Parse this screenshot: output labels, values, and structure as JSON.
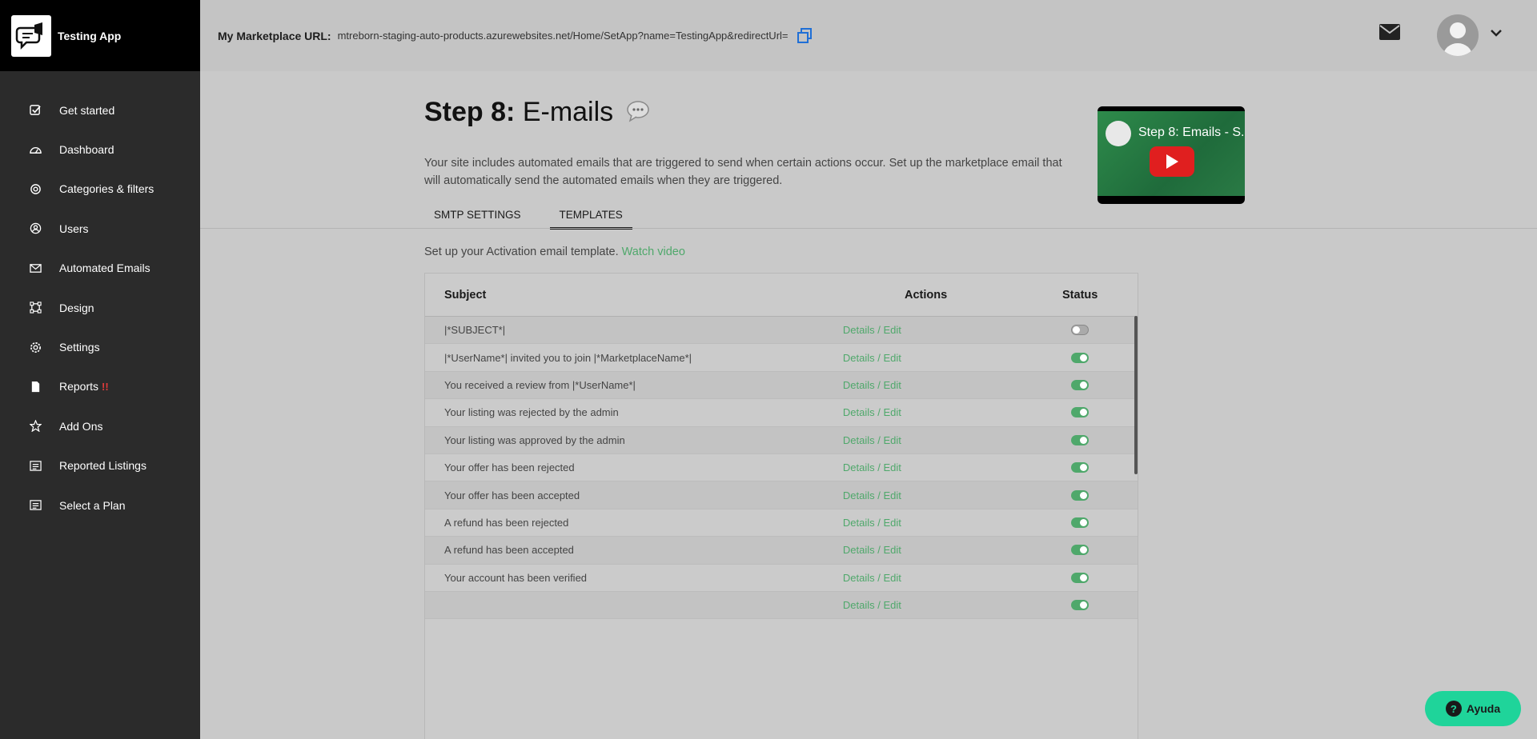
{
  "app": {
    "name": "Testing App"
  },
  "sidebar": {
    "items": [
      {
        "label": "Get started",
        "icon": "checkbox-icon"
      },
      {
        "label": "Dashboard",
        "icon": "gauge-icon"
      },
      {
        "label": "Categories & filters",
        "icon": "target-icon"
      },
      {
        "label": "Users",
        "icon": "user-circle-icon"
      },
      {
        "label": "Automated Emails",
        "icon": "envelope-icon"
      },
      {
        "label": "Design",
        "icon": "design-frame-icon"
      },
      {
        "label": "Settings",
        "icon": "gear-icon"
      },
      {
        "label": "Reports",
        "icon": "document-icon",
        "badge": "!!"
      },
      {
        "label": "Add Ons",
        "icon": "star-icon"
      },
      {
        "label": "Reported Listings",
        "icon": "list-icon"
      },
      {
        "label": "Select a Plan",
        "icon": "list-icon"
      }
    ]
  },
  "header": {
    "url_label": "My Marketplace URL:",
    "url_value": "mtreborn-staging-auto-products.azurewebsites.net/Home/SetApp?name=TestingApp&redirectUrl="
  },
  "page": {
    "step_bold": "Step 8:",
    "step_rest": "E-mails",
    "description": "Your site includes automated emails that are triggered to send when certain actions occur. Set up the marketplace email that will automatically send the automated emails when they are triggered.",
    "video_title": "Step 8: Emails - S..."
  },
  "tabs": [
    {
      "label": "SMTP SETTINGS",
      "active": false
    },
    {
      "label": "TEMPLATES",
      "active": true
    }
  ],
  "intro": {
    "text": "Set up your Activation email template.",
    "link": "Watch video"
  },
  "table": {
    "headers": {
      "subject": "Subject",
      "actions": "Actions",
      "status": "Status"
    },
    "action_label": "Details / Edit",
    "rows": [
      {
        "subject": "|*SUBJECT*|",
        "enabled": false
      },
      {
        "subject": "|*UserName*| invited you to join |*MarketplaceName*|",
        "enabled": true
      },
      {
        "subject": "You received a review from |*UserName*|",
        "enabled": true
      },
      {
        "subject": "Your listing was rejected by the admin",
        "enabled": true
      },
      {
        "subject": "Your listing was approved by the admin",
        "enabled": true
      },
      {
        "subject": "Your offer has been rejected",
        "enabled": true
      },
      {
        "subject": "Your offer has been accepted",
        "enabled": true
      },
      {
        "subject": "A refund has been rejected",
        "enabled": true
      },
      {
        "subject": "A refund has been accepted",
        "enabled": true
      },
      {
        "subject": "Your account has been verified",
        "enabled": true
      },
      {
        "subject": "",
        "enabled": true
      }
    ]
  },
  "help": {
    "label": "Ayuda"
  },
  "colors": {
    "accent": "#4fa86b",
    "help": "#1fd49a",
    "sidebar": "#2b2b2b"
  }
}
